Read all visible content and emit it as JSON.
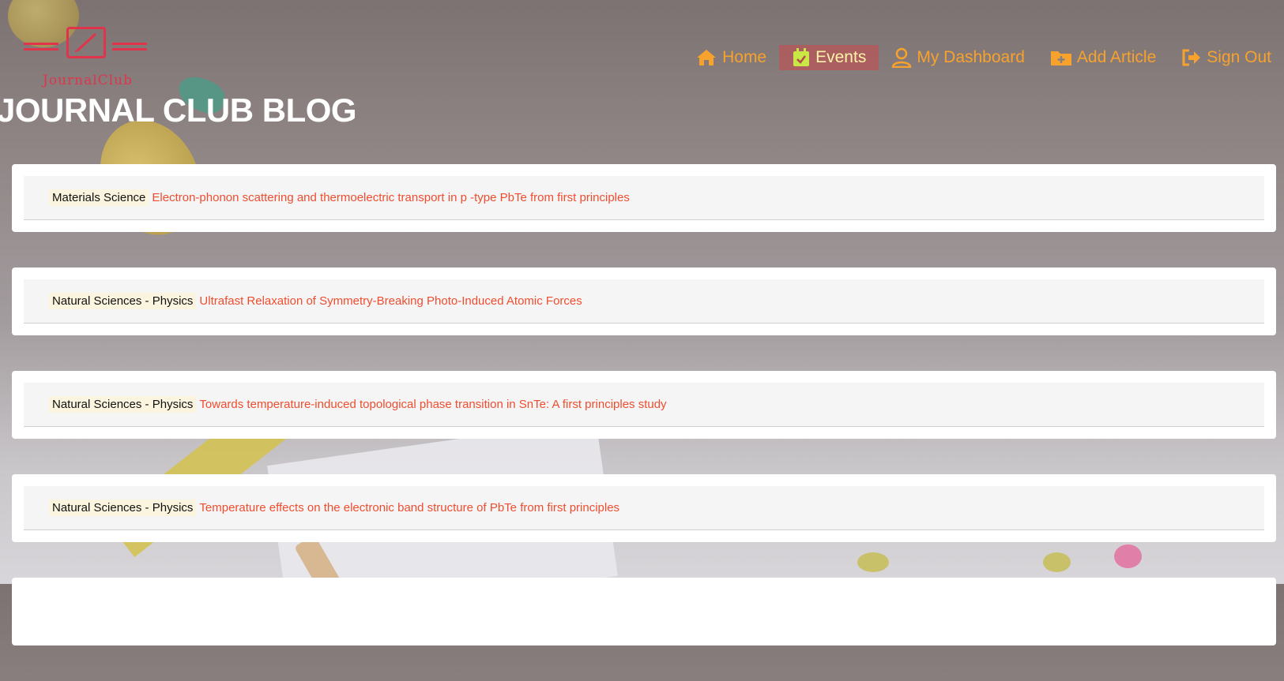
{
  "logo": {
    "text": "JournalClub"
  },
  "nav": {
    "items": [
      {
        "label": "Home",
        "icon": "home-icon",
        "active": false
      },
      {
        "label": "Events",
        "icon": "calendar-check-icon",
        "active": true
      },
      {
        "label": "My Dashboard",
        "icon": "user-icon",
        "active": false
      },
      {
        "label": "Add Article",
        "icon": "folder-plus-icon",
        "active": false
      },
      {
        "label": "Sign Out",
        "icon": "sign-out-icon",
        "active": false
      }
    ]
  },
  "page": {
    "title": "JOURNAL CLUB BLOG"
  },
  "articles": [
    {
      "category": "Materials Science",
      "title": "Electron-phonon scattering and thermoelectric transport in p -type PbTe from first principles"
    },
    {
      "category": "Natural Sciences - Physics",
      "title": "Ultrafast Relaxation of Symmetry-Breaking Photo-Induced Atomic Forces"
    },
    {
      "category": "Natural Sciences - Physics",
      "title": "Towards temperature-induced topological phase transition in SnTe: A first principles study"
    },
    {
      "category": "Natural Sciences - Physics",
      "title": "Temperature effects on the electronic band structure of PbTe from first principles"
    }
  ],
  "colors": {
    "accent": "#f7a22c",
    "link": "#ef4d2f",
    "logo": "#e0344b",
    "active_bg": "#cc484a"
  }
}
